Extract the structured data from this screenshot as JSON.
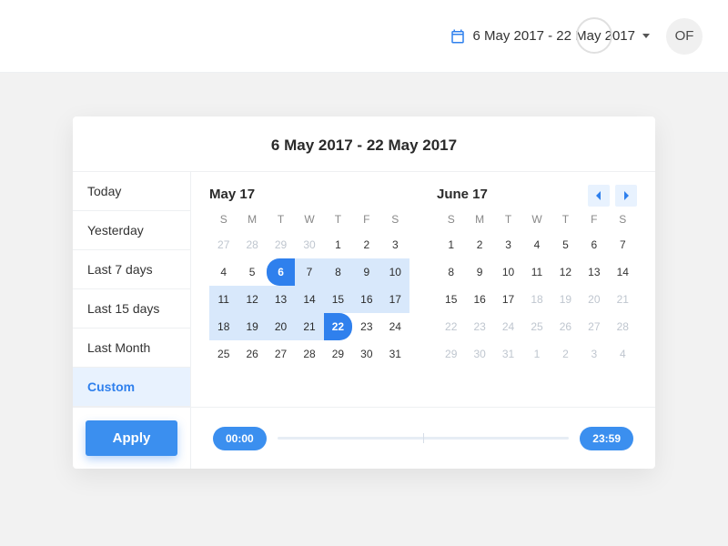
{
  "topbar": {
    "range_label": "6 May 2017 - 22 May 2017",
    "avatar_initials": "OF"
  },
  "panel": {
    "title": "6 May 2017 - 22 May 2017",
    "presets": [
      "Today",
      "Yesterday",
      "Last 7 days",
      "Last 15 days",
      "Last Month",
      "Custom"
    ],
    "active_preset": "Custom",
    "apply_label": "Apply"
  },
  "cal_left": {
    "month": "May 17",
    "dow": [
      "S",
      "M",
      "T",
      "W",
      "T",
      "F",
      "S"
    ],
    "days": [
      {
        "n": 27,
        "o": 1
      },
      {
        "n": 28,
        "o": 1
      },
      {
        "n": 29,
        "o": 1
      },
      {
        "n": 30,
        "o": 1
      },
      {
        "n": 1
      },
      {
        "n": 2
      },
      {
        "n": 3
      },
      {
        "n": 4
      },
      {
        "n": 5
      },
      {
        "n": 6,
        "s": "start"
      },
      {
        "n": 7,
        "r": 1
      },
      {
        "n": 8,
        "r": 1
      },
      {
        "n": 9,
        "r": 1
      },
      {
        "n": 10,
        "r": 1
      },
      {
        "n": 11,
        "r": 1
      },
      {
        "n": 12,
        "r": 1
      },
      {
        "n": 13,
        "r": 1
      },
      {
        "n": 14,
        "r": 1
      },
      {
        "n": 15,
        "r": 1
      },
      {
        "n": 16,
        "r": 1
      },
      {
        "n": 17,
        "r": 1
      },
      {
        "n": 18,
        "r": 1
      },
      {
        "n": 19,
        "r": 1
      },
      {
        "n": 20,
        "r": 1
      },
      {
        "n": 21,
        "r": 1
      },
      {
        "n": 22,
        "s": "end"
      },
      {
        "n": 23
      },
      {
        "n": 24
      },
      {
        "n": 25
      },
      {
        "n": 26
      },
      {
        "n": 27
      },
      {
        "n": 28
      },
      {
        "n": 29
      },
      {
        "n": 30
      },
      {
        "n": 31
      }
    ]
  },
  "cal_right": {
    "month": "June 17",
    "dow": [
      "S",
      "M",
      "T",
      "W",
      "T",
      "F",
      "S"
    ],
    "days": [
      {
        "n": 1
      },
      {
        "n": 2
      },
      {
        "n": 3
      },
      {
        "n": 4
      },
      {
        "n": 5
      },
      {
        "n": 6
      },
      {
        "n": 7
      },
      {
        "n": 8
      },
      {
        "n": 9
      },
      {
        "n": 10
      },
      {
        "n": 11
      },
      {
        "n": 12
      },
      {
        "n": 13
      },
      {
        "n": 14
      },
      {
        "n": 15
      },
      {
        "n": 16
      },
      {
        "n": 17
      },
      {
        "n": 18,
        "o": 1
      },
      {
        "n": 19,
        "o": 1
      },
      {
        "n": 20,
        "o": 1
      },
      {
        "n": 21,
        "o": 1
      },
      {
        "n": 22,
        "o": 1
      },
      {
        "n": 23,
        "o": 1
      },
      {
        "n": 24,
        "o": 1
      },
      {
        "n": 25,
        "o": 1
      },
      {
        "n": 26,
        "o": 1
      },
      {
        "n": 27,
        "o": 1
      },
      {
        "n": 28,
        "o": 1
      },
      {
        "n": 29,
        "o": 1
      },
      {
        "n": 30,
        "o": 1
      },
      {
        "n": 31,
        "o": 1
      },
      {
        "n": 1,
        "o": 1
      },
      {
        "n": 2,
        "o": 1
      },
      {
        "n": 3,
        "o": 1
      },
      {
        "n": 4,
        "o": 1
      }
    ]
  },
  "time": {
    "start": "00:00",
    "end": "23:59"
  }
}
